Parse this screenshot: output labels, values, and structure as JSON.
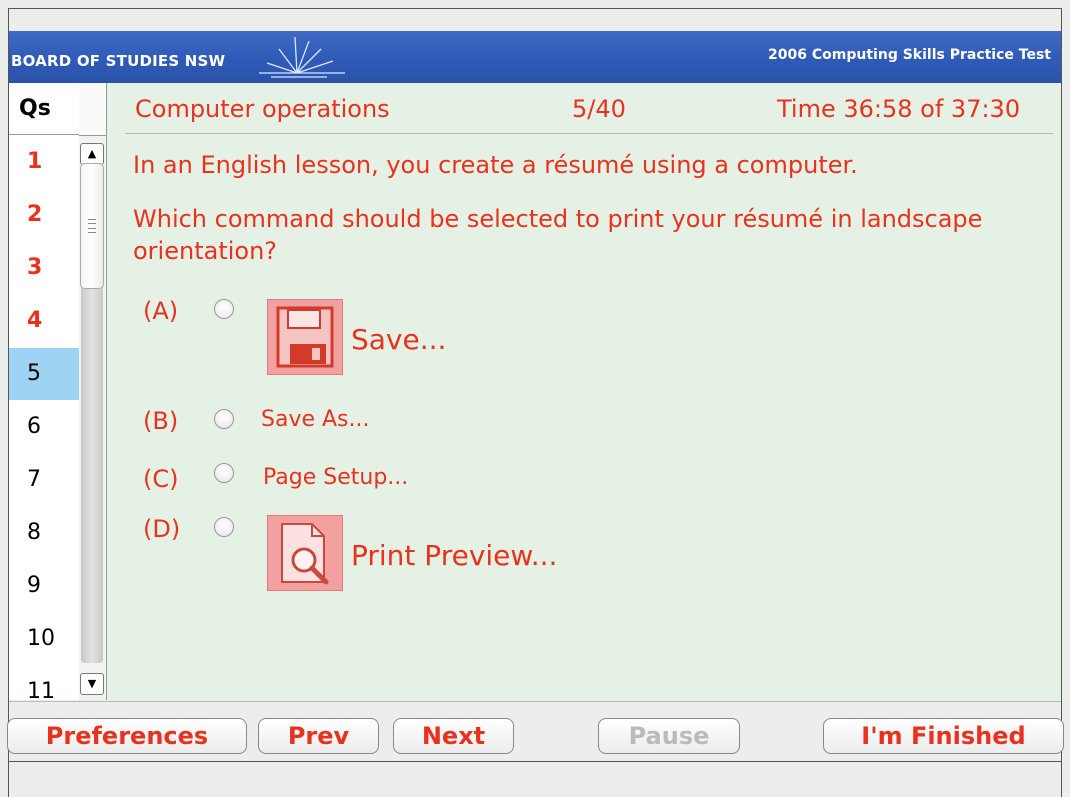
{
  "banner": {
    "org": "BOARD OF STUDIES NSW",
    "test_title": "2006 Computing Skills Practice Test"
  },
  "sidebar": {
    "header": "Qs",
    "items": [
      {
        "label": "1",
        "state": "answered"
      },
      {
        "label": "2",
        "state": "answered"
      },
      {
        "label": "3",
        "state": "answered"
      },
      {
        "label": "4",
        "state": "answered"
      },
      {
        "label": "5",
        "state": "current"
      },
      {
        "label": "6",
        "state": "unanswered"
      },
      {
        "label": "7",
        "state": "unanswered"
      },
      {
        "label": "8",
        "state": "unanswered"
      },
      {
        "label": "9",
        "state": "unanswered"
      },
      {
        "label": "10",
        "state": "unanswered"
      },
      {
        "label": "11",
        "state": "unanswered"
      }
    ]
  },
  "header": {
    "topic": "Computer operations",
    "counter": "5/40",
    "timer": "Time 36:58 of 37:30"
  },
  "question": {
    "line1": "In an English lesson, you create a résumé using a computer.",
    "line2": "Which command should be selected to print your résumé in landscape orientation?"
  },
  "options": [
    {
      "letter": "(A)",
      "text": "Save...",
      "icon": "floppy-disk-icon"
    },
    {
      "letter": "(B)",
      "text": "Save As..."
    },
    {
      "letter": "(C)",
      "text": "Page Setup..."
    },
    {
      "letter": "(D)",
      "text": "Print Preview...",
      "icon": "print-preview-icon"
    }
  ],
  "footer": {
    "preferences": "Preferences",
    "prev": "Prev",
    "next": "Next",
    "pause": "Pause",
    "finished": "I'm Finished"
  },
  "colors": {
    "accent": "#e8321e",
    "banner": "#2f5bb8",
    "current_item": "#9fd3f3",
    "content_bg": "#e4f1e4",
    "disabled": "#bbbbbb"
  }
}
